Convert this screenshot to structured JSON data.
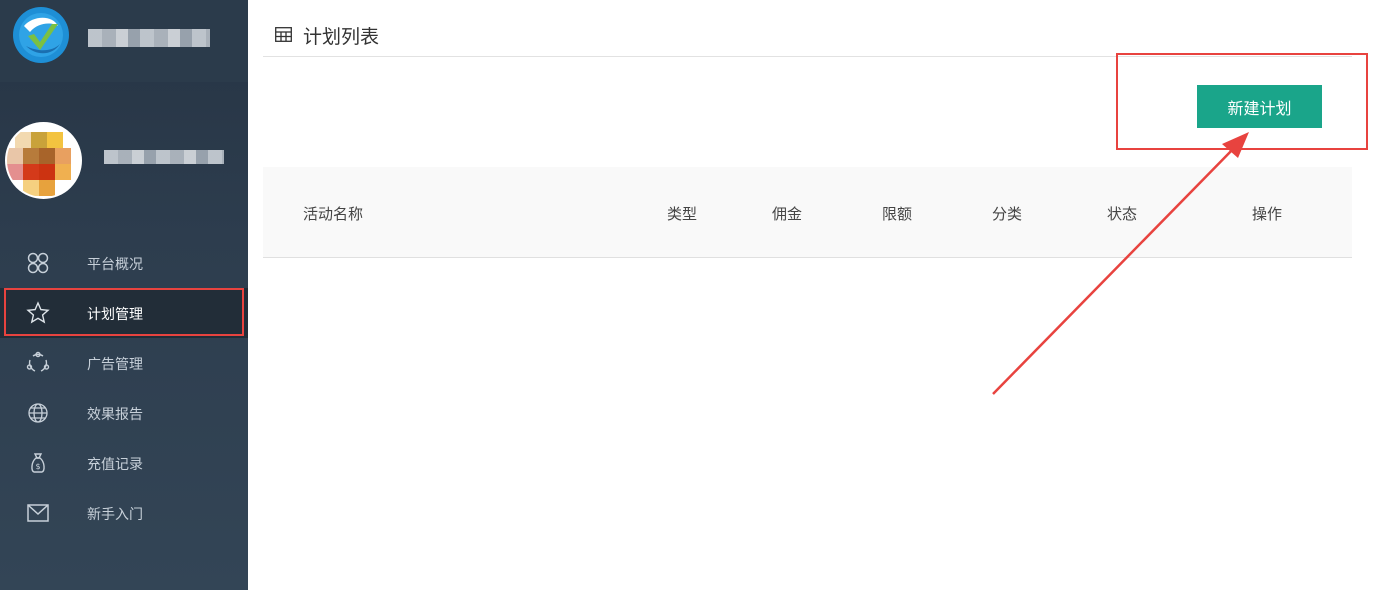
{
  "sidebar": {
    "items": [
      {
        "label": "平台概况",
        "icon": "clover-icon"
      },
      {
        "label": "计划管理",
        "icon": "star-icon"
      },
      {
        "label": "广告管理",
        "icon": "share-circle-icon"
      },
      {
        "label": "效果报告",
        "icon": "globe-icon"
      },
      {
        "label": "充值记录",
        "icon": "money-bag-icon"
      },
      {
        "label": "新手入门",
        "icon": "envelope-icon"
      }
    ],
    "active_index": 1
  },
  "main": {
    "title": "计划列表",
    "new_button_label": "新建计划",
    "table": {
      "columns": [
        "活动名称",
        "类型",
        "佣金",
        "限额",
        "分类",
        "状态",
        "操作"
      ],
      "rows": []
    }
  },
  "colors": {
    "sidebar_bg": "#2d3d4e",
    "accent": "#1aa58a",
    "highlight": "#e8433f"
  }
}
